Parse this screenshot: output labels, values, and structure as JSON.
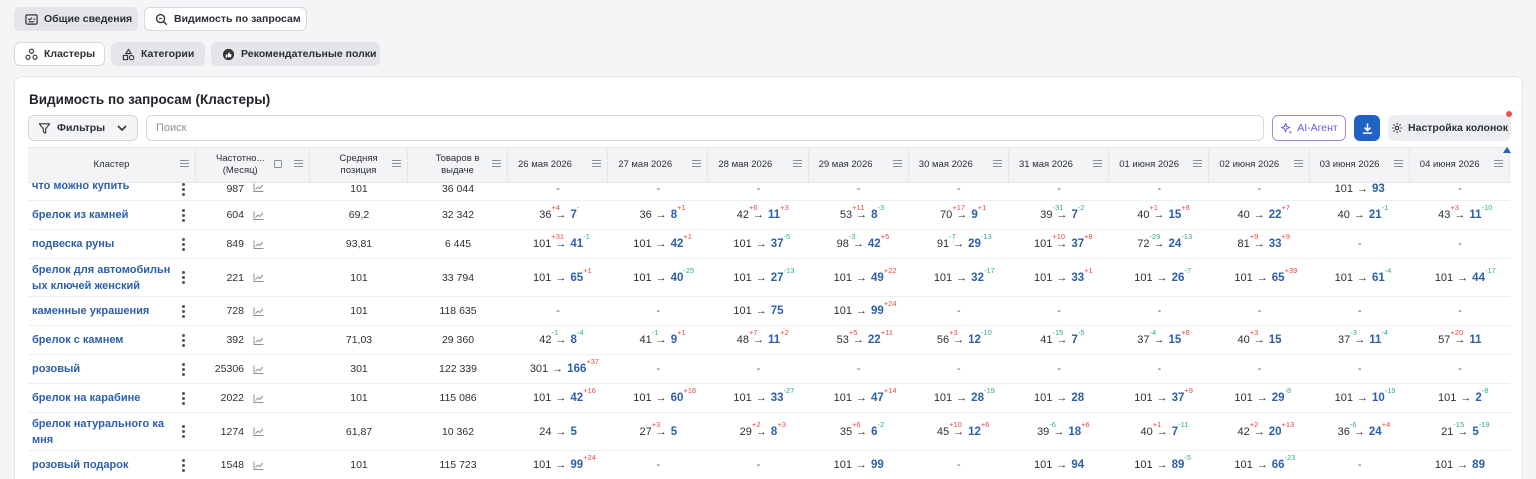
{
  "tabs_top": [
    "Общие сведения",
    "Видимость по запросам"
  ],
  "tabs_sub": [
    "Кластеры",
    "Категории",
    "Рекомендательные полки"
  ],
  "card": {
    "title": "Видимость по запросам (Кластеры)",
    "filters_label": "Фильтры",
    "search_placeholder": "Поиск",
    "ai_label": "AI-Агент",
    "columns_label": "Настройка колонок"
  },
  "headers": {
    "cluster": "Кластер",
    "freq": [
      "Частотно...",
      "(Месяц)"
    ],
    "avg": [
      "Средняя",
      "позиция"
    ],
    "goods": [
      "Товаров в",
      "выдаче"
    ],
    "dates": [
      "26 мая 2026",
      "27 мая 2026",
      "28 мая 2026",
      "29 мая 2026",
      "30 мая 2026",
      "31 мая 2026",
      "01 июня 2026",
      "02 июня 2026",
      "03 июня 2026",
      "04 июня 2026"
    ]
  },
  "rows": [
    {
      "kw": [
        "что можно купить"
      ],
      "freq": "987",
      "avg": "101",
      "goods": "36 044",
      "pos": [
        null,
        null,
        null,
        null,
        null,
        null,
        null,
        null,
        [
          "101",
          "93",
          "",
          ""
        ],
        null
      ]
    },
    {
      "kw": [
        "брелок из камней"
      ],
      "freq": "604",
      "avg": "69,2",
      "goods": "32 342",
      "pos": [
        [
          "36",
          "7",
          "+4",
          "-"
        ],
        [
          "36",
          "8",
          "",
          "+1"
        ],
        [
          "42",
          "11",
          "+6",
          "+3"
        ],
        [
          "53",
          "8",
          "+11",
          "-3"
        ],
        [
          "70",
          "9",
          "+17",
          "+1"
        ],
        [
          "39",
          "7",
          "-31",
          "-2"
        ],
        [
          "40",
          "15",
          "+1",
          "+8"
        ],
        [
          "40",
          "22",
          "",
          "+7"
        ],
        [
          "40",
          "21",
          "",
          "-1"
        ],
        [
          "43",
          "11",
          "+3",
          "-10"
        ]
      ]
    },
    {
      "kw": [
        "подвеска руны"
      ],
      "freq": "849",
      "avg": "93,81",
      "goods": "6 445",
      "pos": [
        [
          "101",
          "41",
          "+31",
          "-1"
        ],
        [
          "101",
          "42",
          "",
          "+1"
        ],
        [
          "101",
          "37",
          "",
          "-5"
        ],
        [
          "98",
          "42",
          "-3",
          "+5"
        ],
        [
          "91",
          "29",
          "-7",
          "-13"
        ],
        [
          "101",
          "37",
          "+10",
          "+8"
        ],
        [
          "72",
          "24",
          "-29",
          "-13"
        ],
        [
          "81",
          "33",
          "+9",
          "+9"
        ],
        null,
        null
      ]
    },
    {
      "kw": [
        "брелок для автомобильн",
        "ых ключей женский"
      ],
      "freq": "221",
      "avg": "101",
      "goods": "33 794",
      "pos": [
        [
          "101",
          "65",
          "",
          "+1"
        ],
        [
          "101",
          "40",
          "",
          "-25"
        ],
        [
          "101",
          "27",
          "",
          "-13"
        ],
        [
          "101",
          "49",
          "",
          "+22"
        ],
        [
          "101",
          "32",
          "",
          "-17"
        ],
        [
          "101",
          "33",
          "",
          "+1"
        ],
        [
          "101",
          "26",
          "",
          "-7"
        ],
        [
          "101",
          "65",
          "",
          "+39"
        ],
        [
          "101",
          "61",
          "",
          "-4"
        ],
        [
          "101",
          "44",
          "",
          "-17"
        ]
      ]
    },
    {
      "kw": [
        "каменные украшения"
      ],
      "freq": "728",
      "avg": "101",
      "goods": "118 635",
      "pos": [
        null,
        null,
        [
          "101",
          "75",
          "",
          ""
        ],
        [
          "101",
          "99",
          "",
          "+24"
        ],
        null,
        null,
        null,
        null,
        null,
        null
      ]
    },
    {
      "kw": [
        "брелок с камнем"
      ],
      "freq": "392",
      "avg": "71,03",
      "goods": "29 360",
      "pos": [
        [
          "42",
          "8",
          "-1",
          "-4"
        ],
        [
          "41",
          "9",
          "-1",
          "+1"
        ],
        [
          "48",
          "11",
          "+7",
          "+2"
        ],
        [
          "53",
          "22",
          "+5",
          "+11"
        ],
        [
          "56",
          "12",
          "+3",
          "-10"
        ],
        [
          "41",
          "7",
          "-15",
          "-5"
        ],
        [
          "37",
          "15",
          "-4",
          "+8"
        ],
        [
          "40",
          "15",
          "+3",
          ""
        ],
        [
          "37",
          "11",
          "-3",
          "-4"
        ],
        [
          "57",
          "11",
          "+20",
          ""
        ]
      ]
    },
    {
      "kw": [
        "розовый"
      ],
      "freq": "25306",
      "avg": "301",
      "goods": "122 339",
      "pos": [
        [
          "301",
          "166",
          "",
          "+37"
        ],
        null,
        null,
        null,
        null,
        null,
        null,
        null,
        null,
        null
      ]
    },
    {
      "kw": [
        "брелок на карабине"
      ],
      "freq": "2022",
      "avg": "101",
      "goods": "115 086",
      "pos": [
        [
          "101",
          "42",
          "",
          "+16"
        ],
        [
          "101",
          "60",
          "",
          "+18"
        ],
        [
          "101",
          "33",
          "",
          "-27"
        ],
        [
          "101",
          "47",
          "",
          "+14"
        ],
        [
          "101",
          "28",
          "",
          "-19"
        ],
        [
          "101",
          "28",
          "",
          ""
        ],
        [
          "101",
          "37",
          "",
          "+9"
        ],
        [
          "101",
          "29",
          "",
          "-8"
        ],
        [
          "101",
          "10",
          "",
          "-19"
        ],
        [
          "101",
          "2",
          "",
          "-8"
        ]
      ]
    },
    {
      "kw": [
        "брелок натурального ка",
        "мня"
      ],
      "freq": "1274",
      "avg": "61,87",
      "goods": "10 362",
      "pos": [
        [
          "24",
          "5",
          "",
          ""
        ],
        [
          "27",
          "5",
          "+3",
          ""
        ],
        [
          "29",
          "8",
          "+2",
          "+3"
        ],
        [
          "35",
          "6",
          "+6",
          "-2"
        ],
        [
          "45",
          "12",
          "+10",
          "+6"
        ],
        [
          "39",
          "18",
          "-6",
          "+6"
        ],
        [
          "40",
          "7",
          "+1",
          "-11"
        ],
        [
          "42",
          "20",
          "+2",
          "+13"
        ],
        [
          "36",
          "24",
          "-6",
          "+4"
        ],
        [
          "21",
          "5",
          "-15",
          "-19"
        ]
      ]
    },
    {
      "kw": [
        "розовый подарок"
      ],
      "freq": "1548",
      "avg": "101",
      "goods": "115 723",
      "pos": [
        [
          "101",
          "99",
          "",
          "+24"
        ],
        null,
        null,
        [
          "101",
          "99",
          "",
          ""
        ],
        null,
        [
          "101",
          "94",
          "",
          ""
        ],
        [
          "101",
          "89",
          "",
          "-5"
        ],
        [
          "101",
          "66",
          "",
          "-23"
        ],
        null,
        [
          "101",
          "89",
          "",
          ""
        ]
      ]
    }
  ],
  "dash": "-",
  "arrow": "→"
}
